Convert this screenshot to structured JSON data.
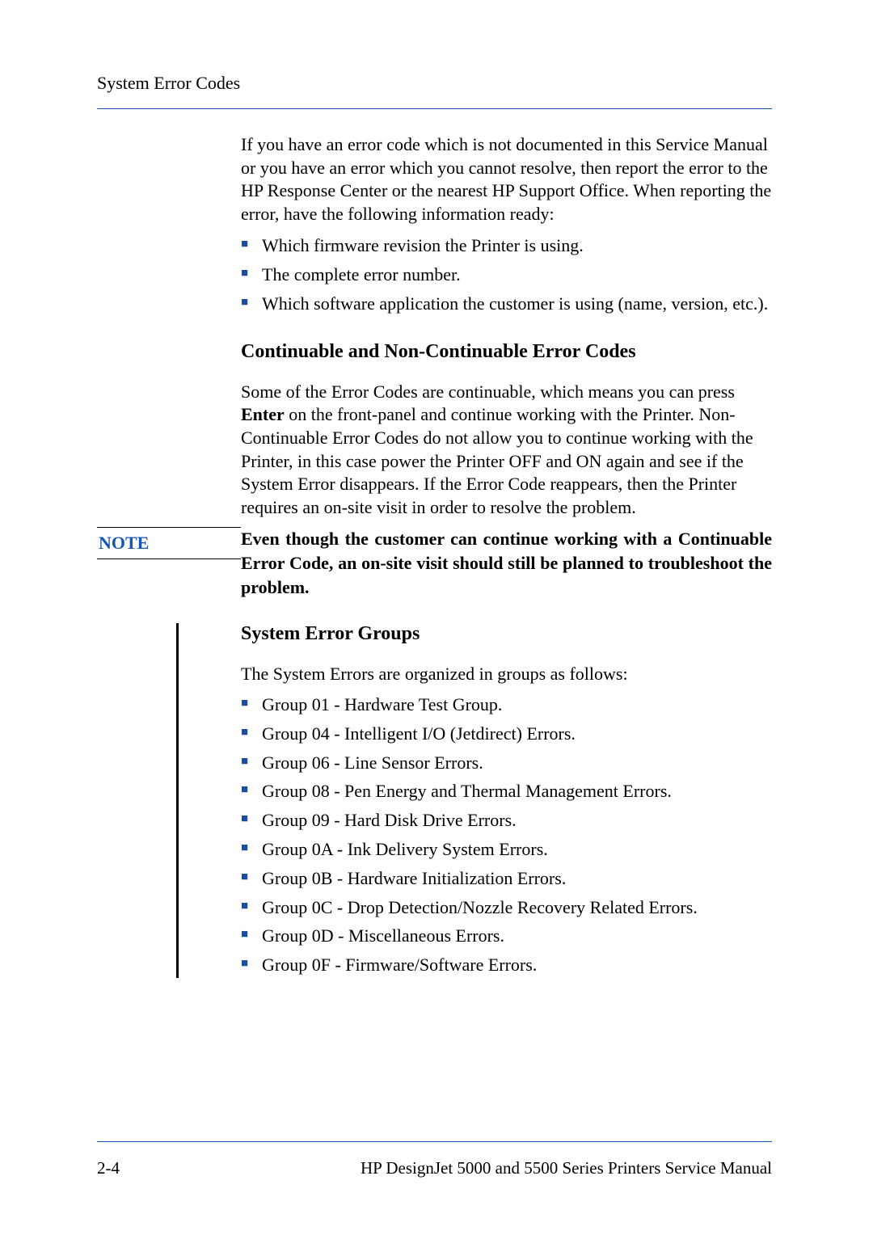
{
  "header": {
    "title": "System Error Codes"
  },
  "intro": {
    "paragraph": "If you have an error code which is not documented in this Service Manual or you have an error which you cannot resolve, then report the error to the HP Response Center or the nearest HP Support Office. When reporting the error, have the following information ready:",
    "bullets": [
      "Which firmware revision the Printer is using.",
      "The complete error number.",
      "Which software application the customer is using (name, version, etc.)."
    ]
  },
  "section1": {
    "heading": "Continuable and Non-Continuable Error Codes",
    "para_prefix": "Some of the Error Codes are continuable, which means you can press ",
    "enter_word": "Enter",
    "para_suffix": " on the front-panel and continue working with the Printer. Non-Continuable Error Codes do not allow you to continue working with the Printer, in this case power the Printer OFF and ON again and see if the System Error disappears. If the Error Code reappears, then the Printer requires an on-site visit in order to resolve the problem."
  },
  "note": {
    "label": "NOTE",
    "text": "Even though the customer can continue working with a Continuable Error Code, an on-site visit should still be planned to troubleshoot the problem."
  },
  "section2": {
    "heading": "System Error Groups",
    "intro": "The System Errors are organized in groups as follows:",
    "bullets": [
      "Group 01 - Hardware Test Group.",
      "Group 04 - Intelligent I/O (Jetdirect) Errors.",
      "Group 06 - Line Sensor Errors.",
      "Group 08 - Pen Energy and Thermal Management Errors.",
      "Group 09 - Hard Disk Drive Errors.",
      "Group 0A - Ink Delivery System Errors.",
      "Group 0B - Hardware Initialization Errors.",
      "Group 0C - Drop Detection/Nozzle Recovery Related Errors.",
      "Group 0D - Miscellaneous Errors.",
      "Group 0F - Firmware/Software Errors."
    ]
  },
  "footer": {
    "page_num": "2-4",
    "doc_title": "HP DesignJet 5000 and 5500 Series Printers Service Manual"
  }
}
